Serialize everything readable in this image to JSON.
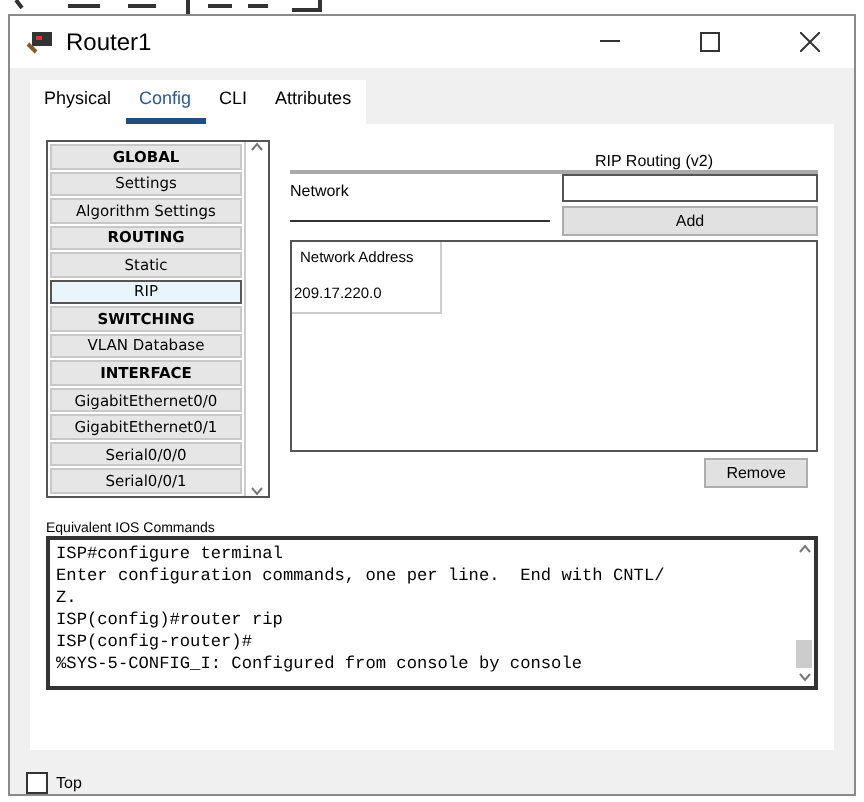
{
  "window": {
    "title": "Router1"
  },
  "tabs": [
    {
      "label": "Physical",
      "selected": false
    },
    {
      "label": "Config",
      "selected": true
    },
    {
      "label": "CLI",
      "selected": false
    },
    {
      "label": "Attributes",
      "selected": false
    }
  ],
  "sidebar": {
    "items": [
      {
        "label": "GLOBAL",
        "kind": "header",
        "selected": false
      },
      {
        "label": "Settings",
        "kind": "item",
        "selected": false
      },
      {
        "label": "Algorithm Settings",
        "kind": "item",
        "selected": false
      },
      {
        "label": "ROUTING",
        "kind": "header",
        "selected": false
      },
      {
        "label": "Static",
        "kind": "item",
        "selected": false
      },
      {
        "label": "RIP",
        "kind": "item",
        "selected": true
      },
      {
        "label": "SWITCHING",
        "kind": "header",
        "selected": false
      },
      {
        "label": "VLAN Database",
        "kind": "item",
        "selected": false
      },
      {
        "label": "INTERFACE",
        "kind": "header",
        "selected": false
      },
      {
        "label": "GigabitEthernet0/0",
        "kind": "item",
        "selected": false
      },
      {
        "label": "GigabitEthernet0/1",
        "kind": "item",
        "selected": false
      },
      {
        "label": "Serial0/0/0",
        "kind": "item",
        "selected": false
      },
      {
        "label": "Serial0/0/1",
        "kind": "item",
        "selected": false
      }
    ]
  },
  "rip": {
    "title": "RIP Routing (v2)",
    "network_label": "Network",
    "add_button": "Add",
    "table": {
      "column": "Network Address",
      "rows": [
        "209.17.220.0"
      ]
    },
    "remove_button": "Remove"
  },
  "console": {
    "label": "Equivalent IOS Commands",
    "lines": [
      "ISP#configure terminal",
      "Enter configuration commands, one per line.  End with CNTL/",
      "Z.",
      "ISP(config)#router rip",
      "ISP(config-router)#",
      "%SYS-5-CONFIG_I: Configured from console by console"
    ]
  },
  "top_checkbox": {
    "label": "Top",
    "checked": false
  }
}
